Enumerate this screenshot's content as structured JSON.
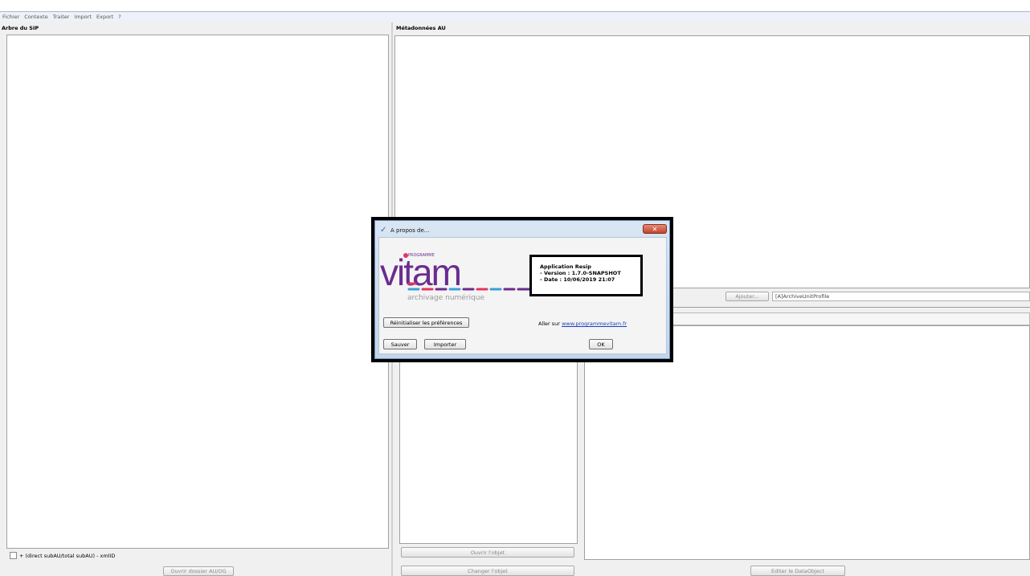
{
  "menu": [
    "Fichier",
    "Contexte",
    "Traiter",
    "Import",
    "Export",
    "?"
  ],
  "left_panel": {
    "title": "Arbre du SIP",
    "checkbox_label": "+ (direct subAU/total subAU) - xmlID",
    "open_folder_button": "Ouvrir dossier AU/OG"
  },
  "right_panel": {
    "title": "Métadonnées AU",
    "add_button": "Ajouter...",
    "profile_field": "[A]ArchiveUnitProfile",
    "open_object_button": "Ouvrir l'objet",
    "change_object_button": "Changer l'objet",
    "edit_dataobject_button": "Editer le DataObject"
  },
  "dialog": {
    "title": "A propos de...",
    "logo": {
      "small_label": "PROGRAMME",
      "brand": "vitam",
      "tagline": "archivage numérique"
    },
    "info": {
      "app_name": "Application Resip",
      "version": "- Version : 1.7.0-SNAPSHOT",
      "date": "- Date : 10/06/2019 21:07"
    },
    "reset_button": "Réinitialiser les préférences",
    "goto_prefix": "Aller sur",
    "goto_link": "www.programmevitam.fr",
    "save_button": "Sauver",
    "import_button": "Importer",
    "ok_button": "OK"
  },
  "colors": {
    "logo_purple": "#6a2c8e",
    "logo_blue": "#3aa0d8",
    "logo_red": "#e2375b"
  }
}
